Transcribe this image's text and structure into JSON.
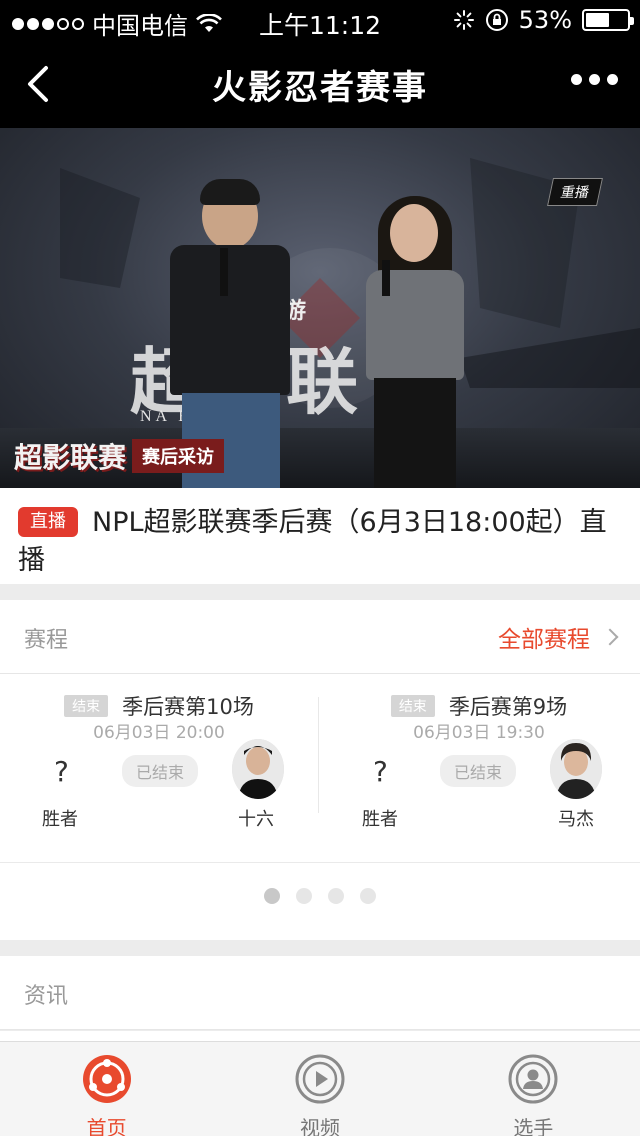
{
  "status_bar": {
    "carrier": "中国电信",
    "time": "上午11:12",
    "battery": "53%",
    "signal_bars": 3
  },
  "nav": {
    "title": "火影忍者赛事"
  },
  "video": {
    "replay_badge": "重播",
    "shouyou": "手游",
    "brush_text": "超影联",
    "pro_text": "NA        E PRO L",
    "corner_logo": "超影联赛",
    "corner_tag": "赛后采访"
  },
  "live": {
    "badge": "直播",
    "text": "NPL超影联赛季后赛（6月3日18:00起）直播"
  },
  "schedule": {
    "label": "赛程",
    "all_link": "全部赛程",
    "matches": [
      {
        "tag": "结束",
        "name": "季后赛第10场",
        "time": "06月03日 20:00",
        "left_mark": "?",
        "left_label": "胜者",
        "status": "已结束",
        "right_player": "十六"
      },
      {
        "tag": "结束",
        "name": "季后赛第9场",
        "time": "06月03日 19:30",
        "left_mark": "?",
        "left_label": "胜者",
        "status": "已结束",
        "right_player": "马杰"
      }
    ],
    "pager": {
      "count": 4,
      "active_index": 0
    }
  },
  "news": {
    "label": "资讯"
  },
  "tabs": [
    {
      "label": "首页",
      "icon": "home-icon",
      "active": true
    },
    {
      "label": "视频",
      "icon": "play-icon",
      "active": false
    },
    {
      "label": "选手",
      "icon": "player-icon",
      "active": false
    }
  ],
  "colors": {
    "accent": "#e84a2e",
    "live_badge": "#e23a2e",
    "nav_bg": "#000000"
  }
}
